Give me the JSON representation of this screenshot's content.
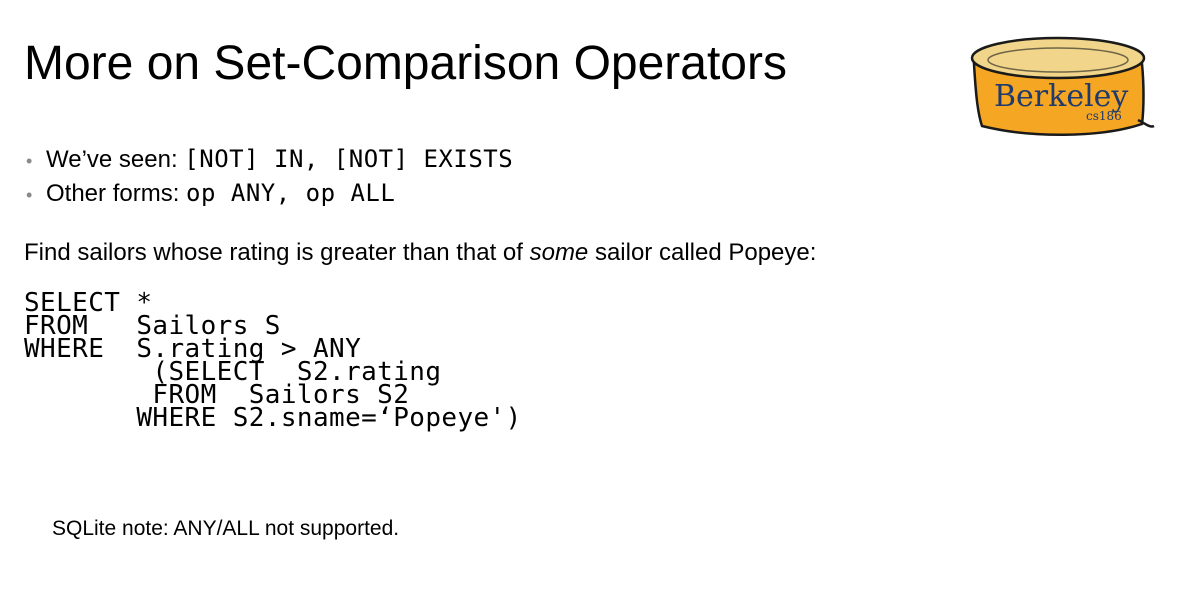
{
  "slide": {
    "title": "More on Set-Comparison Operators",
    "logo": {
      "icon": "berkeley-cs186-logo-icon",
      "text": "Berkeley",
      "subtext": "cs186",
      "fill_color": "#f5a623",
      "rim_color": "#f0d58a",
      "outline_color": "#1a1a1a",
      "text_color": "#1f3a6b"
    },
    "bullets": [
      {
        "label": "We’ve seen: ",
        "code": "[NOT] IN, [NOT] EXISTS"
      },
      {
        "label": "Other forms: ",
        "code": "op ANY, op ALL"
      }
    ],
    "intro": {
      "before": "Find sailors whose rating is greater than that of ",
      "emphasis": "some",
      "after": " sailor called Popeye:"
    },
    "sql_lines": [
      "SELECT *",
      "FROM   Sailors S",
      "WHERE  S.rating > ANY",
      "        (SELECT  S2.rating",
      "        FROM  Sailors S2",
      "       WHERE S2.sname=‘Popeye')"
    ],
    "note": "SQLite note: ANY/ALL not supported."
  }
}
